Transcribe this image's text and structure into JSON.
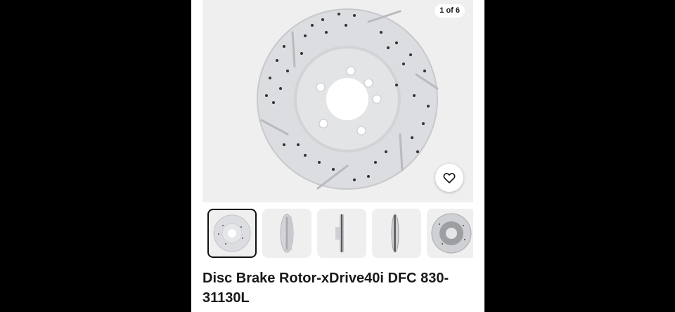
{
  "gallery": {
    "counter": "1 of 6",
    "thumbnails": [
      {
        "view": "face"
      },
      {
        "view": "angle"
      },
      {
        "view": "edge"
      },
      {
        "view": "edge-angle"
      },
      {
        "view": "back"
      }
    ]
  },
  "favorite": {
    "icon": "heart-icon"
  },
  "product": {
    "title": "Disc Brake Rotor-xDrive40i DFC 830-31130L"
  },
  "colors": {
    "background": "#000000",
    "panel": "#ffffff",
    "image_bg": "#efefef",
    "rotor": "#dcdde0",
    "text": "#191919"
  }
}
